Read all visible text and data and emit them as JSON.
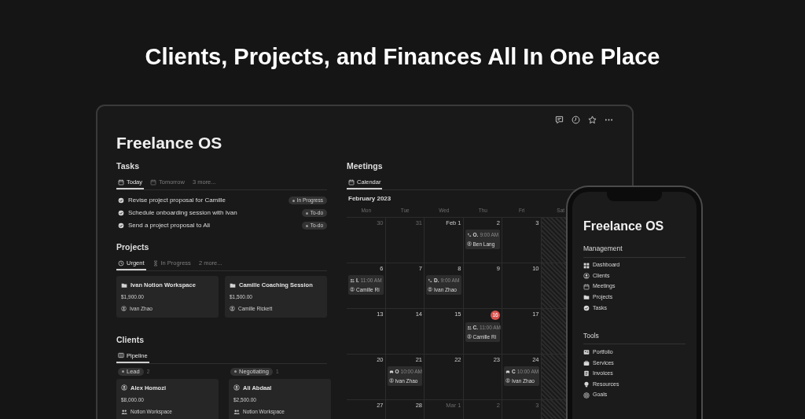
{
  "headline": "Clients, Projects, and Finances All In One Place",
  "page": {
    "title": "Freelance OS"
  },
  "tasks": {
    "heading": "Tasks",
    "tabs": [
      {
        "label": "Today",
        "kind": "calendar",
        "selected": true
      },
      {
        "label": "Tomorrow",
        "kind": "calendar",
        "selected": false
      },
      {
        "label": "3 more...",
        "kind": "more",
        "selected": false
      }
    ],
    "items": [
      {
        "text": "Revise project proposal for Camille",
        "status": "In Progress"
      },
      {
        "text": "Schedule onboarding session with Ivan",
        "status": "To-do"
      },
      {
        "text": "Send a project proposal to Ali",
        "status": "To-do"
      }
    ]
  },
  "projects": {
    "heading": "Projects",
    "tabs": [
      {
        "label": "Urgent",
        "kind": "clock",
        "selected": true
      },
      {
        "label": "In Progress",
        "kind": "hourglass",
        "selected": false
      },
      {
        "label": "2 more...",
        "kind": "more",
        "selected": false
      }
    ],
    "cards": [
      {
        "title": "Ivan Notion Workspace",
        "amount": "$1,900.00",
        "person": "Ivan Zhao"
      },
      {
        "title": "Camille Coaching Session",
        "amount": "$1,500.00",
        "person": "Camille Rickett"
      }
    ]
  },
  "clients": {
    "heading": "Clients",
    "tabs": [
      {
        "label": "Pipeline",
        "kind": "board",
        "selected": true
      }
    ],
    "columns": [
      {
        "label": "Lead",
        "count": "2",
        "cards": [
          {
            "name": "Alex Homozi",
            "amount": "$8,000.00",
            "tag": "Notion Workspace"
          }
        ]
      },
      {
        "label": "Negotiating",
        "count": "1",
        "cards": [
          {
            "name": "Ali Abdaal",
            "amount": "$2,500.00",
            "tag": "Notion Workspace"
          }
        ]
      }
    ]
  },
  "meetings": {
    "heading": "Meetings",
    "tabs": [
      {
        "label": "Calendar",
        "kind": "calendar",
        "selected": true
      }
    ],
    "month": "February 2023",
    "weekdays": [
      {
        "label": "Mon",
        "weekend": false
      },
      {
        "label": "Tue",
        "weekend": false
      },
      {
        "label": "Wed",
        "weekend": false
      },
      {
        "label": "Thu",
        "weekend": false
      },
      {
        "label": "Fri",
        "weekend": false
      },
      {
        "label": "Sat",
        "weekend": true
      }
    ],
    "weeks": [
      [
        {
          "day": "30",
          "muted": true
        },
        {
          "day": "31",
          "muted": true
        },
        {
          "day": "Feb 1",
          "muted": false
        },
        {
          "day": "2",
          "muted": false,
          "events": [
            {
              "kind": "call",
              "title": "O.",
              "time": "9:00 AM",
              "person": "Ben Lang"
            }
          ]
        },
        {
          "day": "3",
          "muted": false
        }
      ],
      [
        {
          "day": "6",
          "muted": false,
          "events": [
            {
              "kind": "group",
              "title": "I.",
              "time": "11:00 AM",
              "person": "Camille Ri"
            }
          ]
        },
        {
          "day": "7",
          "muted": false
        },
        {
          "day": "8",
          "muted": false,
          "events": [
            {
              "kind": "call",
              "title": "D.",
              "time": "9:00 AM",
              "person": "Ivan Zhao"
            }
          ]
        },
        {
          "day": "9",
          "muted": false
        },
        {
          "day": "10",
          "muted": false
        }
      ],
      [
        {
          "day": "13",
          "muted": false
        },
        {
          "day": "14",
          "muted": false
        },
        {
          "day": "15",
          "muted": false
        },
        {
          "day": "16",
          "muted": false,
          "today": true,
          "events": [
            {
              "kind": "group",
              "title": "C.",
              "time": "11:00 AM",
              "person": "Camille Ri"
            }
          ]
        },
        {
          "day": "17",
          "muted": false
        }
      ],
      [
        {
          "day": "20",
          "muted": false
        },
        {
          "day": "21",
          "muted": false,
          "events": [
            {
              "kind": "car",
              "title": "O",
              "time": "10:00 AM",
              "person": "Ivan Zhao"
            }
          ]
        },
        {
          "day": "22",
          "muted": false
        },
        {
          "day": "23",
          "muted": false
        },
        {
          "day": "24",
          "muted": false,
          "events": [
            {
              "kind": "car",
              "title": "C",
              "time": "10:00 AM",
              "person": "Ivan Zhao"
            }
          ]
        }
      ],
      [
        {
          "day": "27",
          "muted": false
        },
        {
          "day": "28",
          "muted": false
        },
        {
          "day": "Mar 1",
          "muted": true
        },
        {
          "day": "2",
          "muted": true
        },
        {
          "day": "3",
          "muted": true
        }
      ]
    ]
  },
  "phone": {
    "title": "Freelance OS",
    "sections": [
      {
        "heading": "Management",
        "items": [
          {
            "label": "Dashboard",
            "kind": "grid"
          },
          {
            "label": "Clients",
            "kind": "person"
          },
          {
            "label": "Meetings",
            "kind": "calendar"
          },
          {
            "label": "Projects",
            "kind": "folder"
          },
          {
            "label": "Tasks",
            "kind": "check"
          }
        ]
      },
      {
        "heading": "Tools",
        "items": [
          {
            "label": "Portfolio",
            "kind": "idcard"
          },
          {
            "label": "Services",
            "kind": "briefcase"
          },
          {
            "label": "Invoices",
            "kind": "document"
          },
          {
            "label": "Resources",
            "kind": "bulb"
          },
          {
            "label": "Goals",
            "kind": "target"
          }
        ]
      }
    ]
  }
}
